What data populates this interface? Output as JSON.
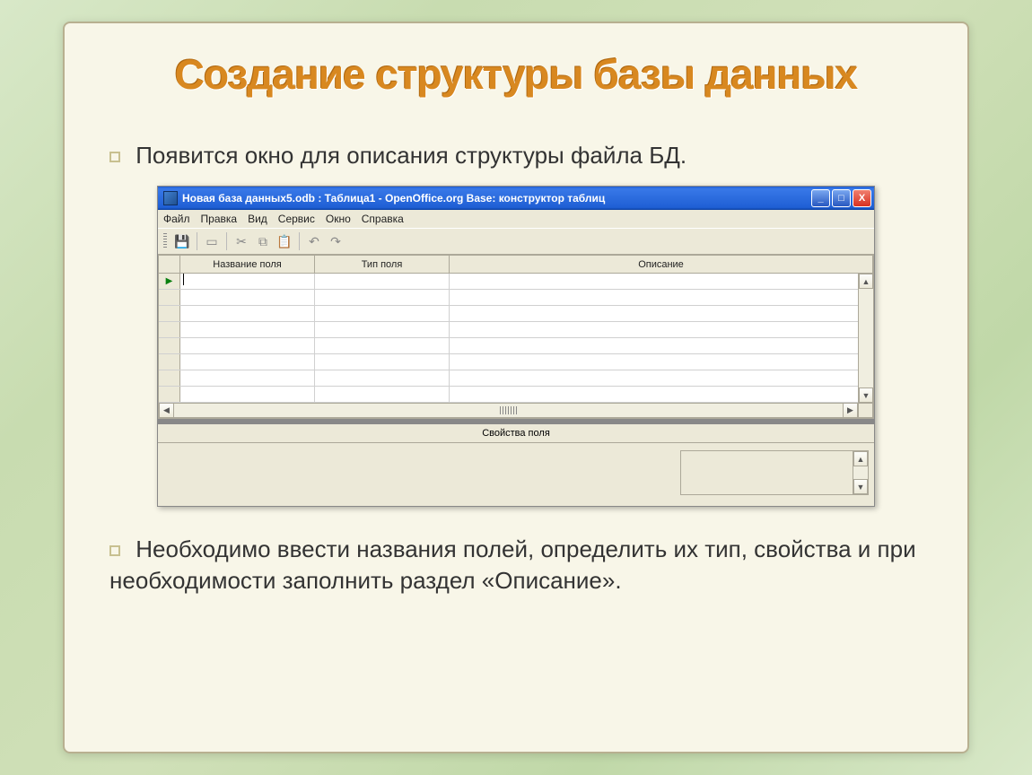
{
  "slide": {
    "title": "Создание структуры базы данных",
    "intro": "Появится окно для описания структуры файла БД.",
    "outro": "Необходимо ввести названия полей, определить их тип, свойства и при необходимости заполнить раздел «Описание»."
  },
  "window": {
    "title": "Новая база данных5.odb : Таблица1 - OpenOffice.org Base: конструктор таблиц",
    "controls": {
      "min": "_",
      "max": "□",
      "close": "X"
    },
    "menu": {
      "file": "Файл",
      "edit": "Правка",
      "view": "Вид",
      "tools": "Сервис",
      "window": "Окно",
      "help": "Справка"
    },
    "table_headers": {
      "name": "Название поля",
      "type": "Тип поля",
      "desc": "Описание"
    },
    "properties_title": "Свойства поля"
  }
}
